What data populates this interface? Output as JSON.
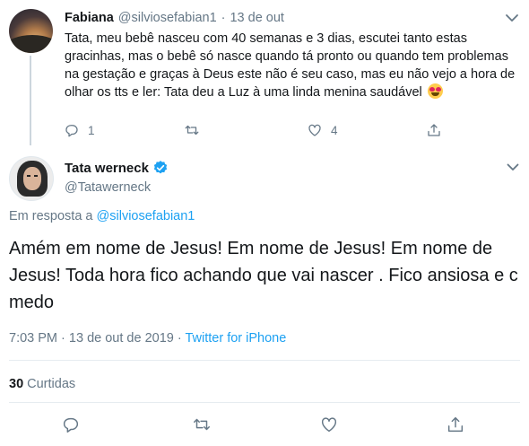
{
  "reply_tweet": {
    "name": "Fabiana",
    "handle": "@silviosefabian1",
    "separator": "·",
    "date": "13 de out",
    "text": "Tata, meu bebê nasceu com 40 semanas e 3 dias, escutei tanto estas gracinhas, mas o bebê só nasce quando tá pronto ou quando tem problemas na gestação  e graças à Deus este não é seu caso, mas eu não vejo a hora de olhar os tts e ler: Tata deu a Luz à uma linda menina saudável",
    "emoji": "heart-eyes-emoji",
    "reply_count": "1",
    "retweet_count": "",
    "like_count": "4"
  },
  "main_tweet": {
    "name": "Tata werneck",
    "handle": "@Tatawerneck",
    "in_reply_prefix": "Em resposta a",
    "in_reply_handle": "@silviosefabian1",
    "text": "Amém em nome de Jesus! Em nome de Jesus! Em nome de Jesus! Toda hora fico achando que vai nascer . Fico ansiosa e c medo",
    "time": "7:03 PM",
    "date": "13 de out de 2019",
    "separator": "·",
    "source": "Twitter for iPhone",
    "likes_count": "30",
    "likes_label": "Curtidas"
  },
  "colors": {
    "accent": "#1da1f2",
    "secondary_text": "#657786",
    "primary_text": "#14171a",
    "divider": "#e6ecf0"
  },
  "icons": [
    "chevron-down-icon",
    "reply-icon",
    "retweet-icon",
    "like-icon",
    "share-icon",
    "verified-badge-icon"
  ]
}
